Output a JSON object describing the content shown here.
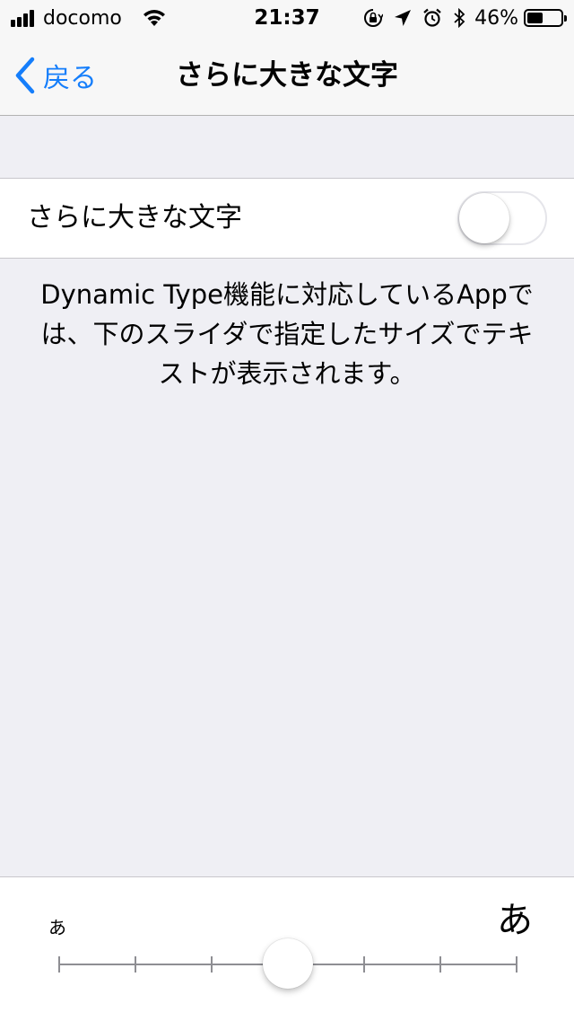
{
  "status_bar": {
    "carrier": "docomo",
    "time": "21:37",
    "battery_percent": "46%",
    "battery_level": 0.46,
    "signal_bars": 4,
    "icons": [
      "wifi-icon",
      "orientation-lock-icon",
      "location-icon",
      "alarm-icon",
      "bluetooth-icon",
      "battery-icon"
    ]
  },
  "nav": {
    "back_label": "戻る",
    "title": "さらに大きな文字"
  },
  "settings": {
    "toggle_label": "さらに大きな文字",
    "toggle_on": false,
    "description": "Dynamic Type機能に対応しているAppでは、下のスライダで指定したサイズでテキストが表示されます。"
  },
  "slider": {
    "small_label": "あ",
    "large_label": "あ",
    "steps": 7,
    "value_index": 3
  },
  "colors": {
    "accent": "#157efb",
    "background": "#efeff4",
    "separator": "#c8c7cc"
  }
}
